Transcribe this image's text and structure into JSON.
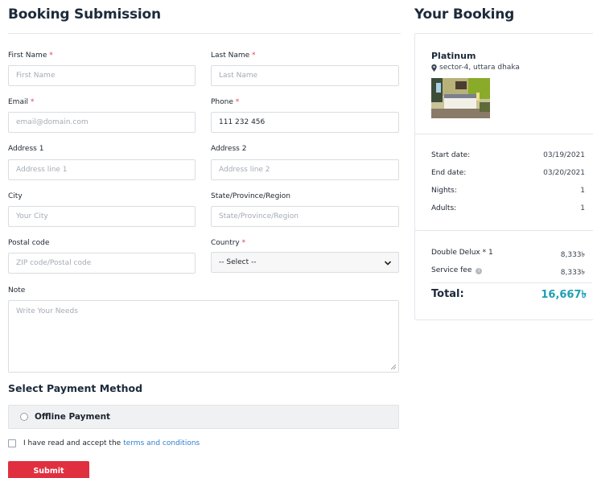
{
  "form": {
    "title": "Booking Submission",
    "required_mark": "*",
    "first_name": {
      "label": "First Name",
      "placeholder": "First Name",
      "value": ""
    },
    "last_name": {
      "label": "Last Name",
      "placeholder": "Last Name",
      "value": ""
    },
    "email": {
      "label": "Email",
      "placeholder": "email@domain.com",
      "value": ""
    },
    "phone": {
      "label": "Phone",
      "placeholder": "",
      "value": "111 232 456"
    },
    "address1": {
      "label": "Address 1",
      "placeholder": "Address line 1",
      "value": ""
    },
    "address2": {
      "label": "Address 2",
      "placeholder": "Address line 2",
      "value": ""
    },
    "city": {
      "label": "City",
      "placeholder": "Your City",
      "value": ""
    },
    "state": {
      "label": "State/Province/Region",
      "placeholder": "State/Province/Region",
      "value": ""
    },
    "postal": {
      "label": "Postal code",
      "placeholder": "ZIP code/Postal code",
      "value": ""
    },
    "country": {
      "label": "Country",
      "selected": "-- Select --"
    },
    "note": {
      "label": "Note",
      "placeholder": "Write Your Needs",
      "value": ""
    }
  },
  "payment": {
    "section_title": "Select Payment Method",
    "option_label": "Offline Payment"
  },
  "terms": {
    "text": "I have read and accept the",
    "link_text": "terms and conditions"
  },
  "submit_label": "Submit",
  "booking": {
    "title": "Your Booking",
    "hotel_name": "Platinum",
    "location": "sector-4, uttara dhaka",
    "start_label": "Start date:",
    "start_value": "03/19/2021",
    "end_label": "End date:",
    "end_value": "03/20/2021",
    "nights_label": "Nights:",
    "nights_value": "1",
    "adults_label": "Adults:",
    "adults_value": "1",
    "room_label": "Double Delux * 1",
    "room_value": "8,333৳",
    "fee_label": "Service fee",
    "fee_value": "8,333৳",
    "total_label": "Total:",
    "total_value": "16,667৳"
  },
  "colors": {
    "required": "#e34050",
    "link": "#2f7fd0",
    "submit": "#e0303f",
    "total": "#1e9fb4"
  },
  "icons": {
    "location": "map-pin-icon",
    "fee_info": "info-icon",
    "select": "chevron-down-icon"
  }
}
